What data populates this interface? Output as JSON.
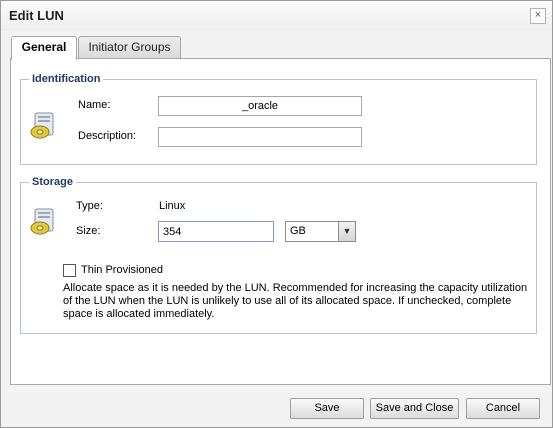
{
  "dialog": {
    "title": "Edit LUN",
    "close_glyph": "×"
  },
  "tabs": [
    {
      "label": "General",
      "active": true
    },
    {
      "label": "Initiator Groups",
      "active": false
    }
  ],
  "identification": {
    "legend": "Identification",
    "icon": "lun-disk-icon",
    "name_label": "Name:",
    "name_value": "_oracle",
    "description_label": "Description:",
    "description_value": ""
  },
  "storage": {
    "legend": "Storage",
    "icon": "lun-disk-icon",
    "type_label": "Type:",
    "type_value": "Linux",
    "size_label": "Size:",
    "size_value": "354",
    "unit_value": "GB",
    "thin_label": "Thin Provisioned",
    "thin_checked": false,
    "thin_description": "Allocate space as it is needed by the LUN. Recommended for increasing the capacity utilization of the LUN when the LUN is unlikely to use all of its allocated space. If unchecked, complete space is allocated immediately."
  },
  "footer": {
    "save_label": "Save",
    "save_close_label": "Save and Close",
    "cancel_label": "Cancel"
  },
  "colors": {
    "legend": "#1e3c64",
    "border": "#b9c3cf"
  }
}
